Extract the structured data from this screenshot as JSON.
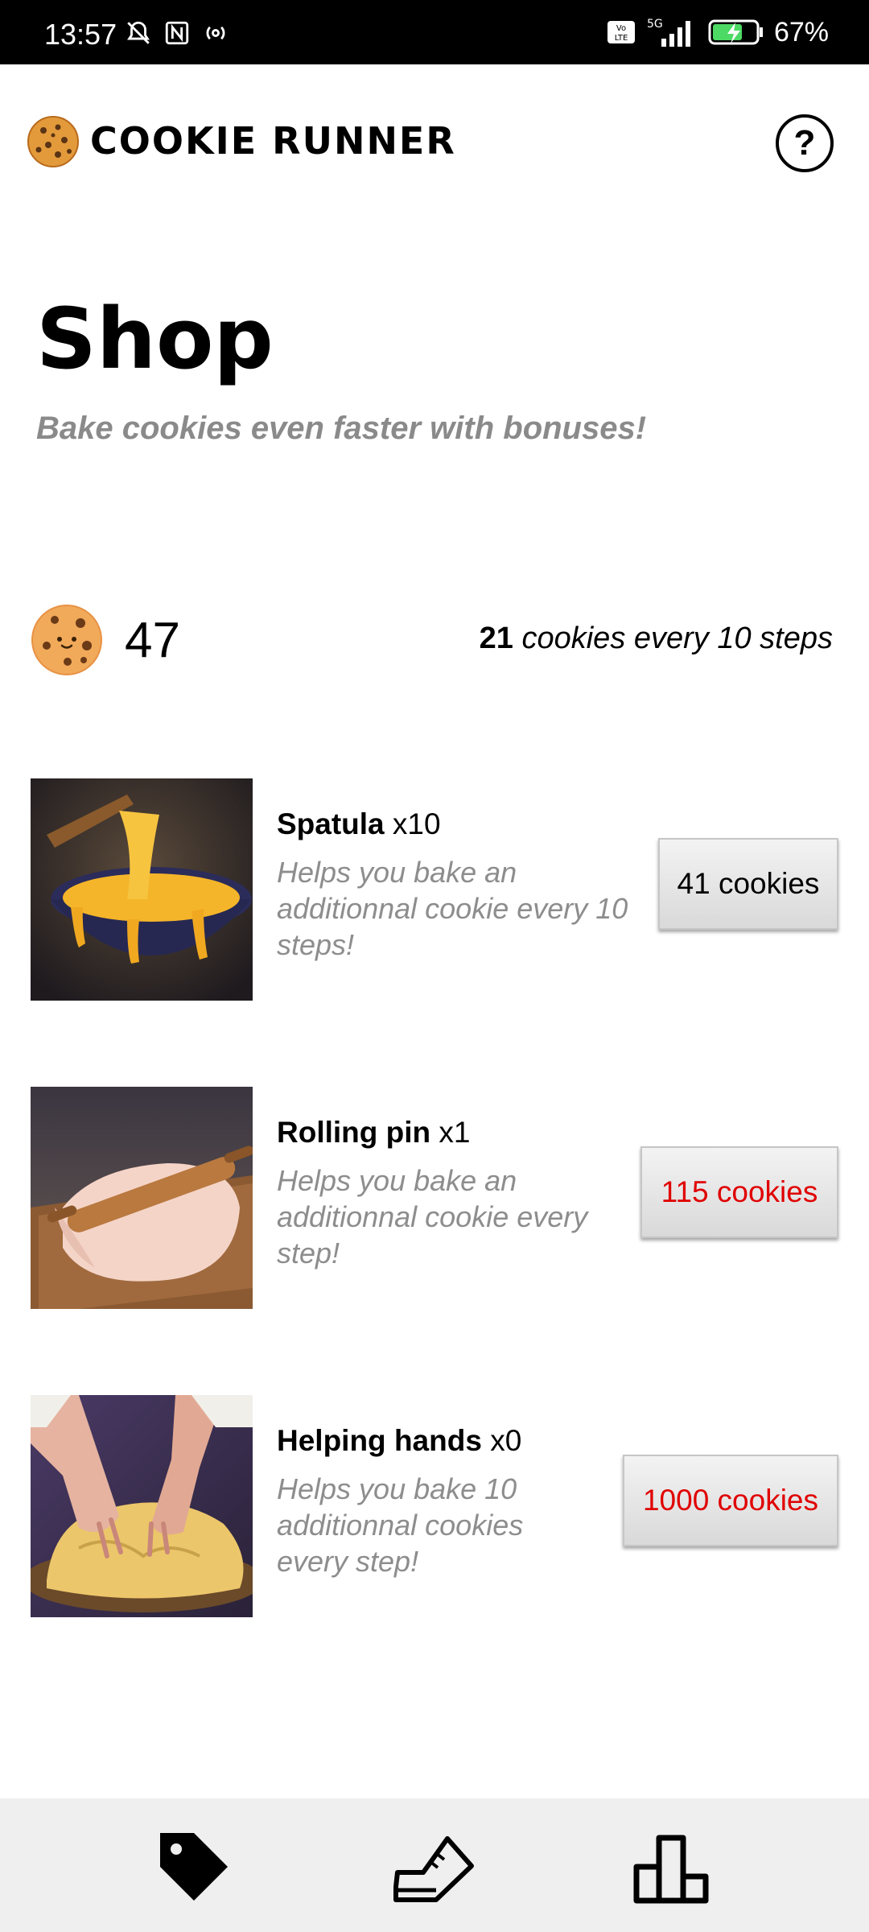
{
  "status_bar": {
    "time": "13:57",
    "battery_percent": "67%",
    "network": "5G",
    "volte": "Vo LTE"
  },
  "header": {
    "app_title": "COOKIE RUNNER",
    "logo_icon": "cookie-icon",
    "help_icon": "help-icon",
    "help_symbol": "?"
  },
  "page": {
    "title": "Shop",
    "subtitle": "Bake cookies even faster with bonuses!"
  },
  "balance": {
    "icon": "cookie-face-icon",
    "count": "47",
    "rate_amount": "21",
    "rate_text": "cookies every 10 steps"
  },
  "items": [
    {
      "name": "Spatula",
      "quantity": "x10",
      "description": "Helps you bake an additionnal cookie every 10 steps!",
      "price": "41 cookies",
      "price_color": "#000000",
      "image": "batter-bowl-image"
    },
    {
      "name": "Rolling pin",
      "quantity": "x1",
      "description": "Helps you bake an additionnal cookie every step!",
      "price": "115 cookies",
      "price_color": "#e00000",
      "image": "rolling-pin-image"
    },
    {
      "name": "Helping hands",
      "quantity": "x0",
      "description": "Helps you bake 10 additionnal cookies every step!",
      "price": "1000 cookies",
      "price_color": "#e00000",
      "image": "kneading-hands-image"
    }
  ],
  "nav": {
    "items": [
      "tag-icon",
      "shoe-icon",
      "leaderboard-icon"
    ]
  }
}
